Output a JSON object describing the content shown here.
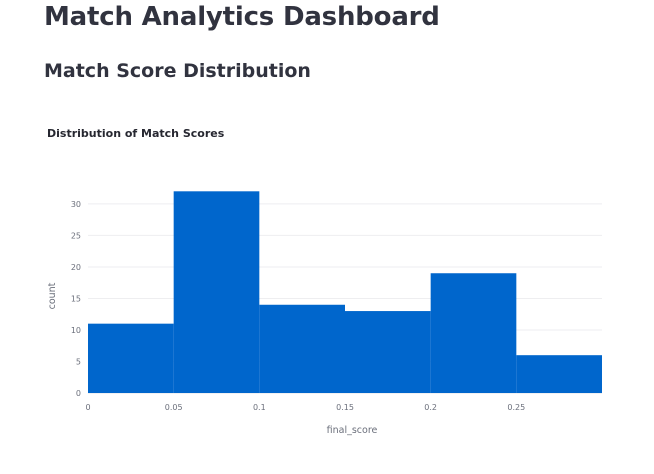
{
  "page": {
    "title": "Match Analytics Dashboard",
    "section_title": "Match Score Distribution"
  },
  "chart_data": {
    "type": "bar",
    "title": "Distribution of Match Scores",
    "xlabel": "final_score",
    "ylabel": "count",
    "bins": [
      {
        "x0": 0.0,
        "x1": 0.05,
        "count": 11
      },
      {
        "x0": 0.05,
        "x1": 0.1,
        "count": 32
      },
      {
        "x0": 0.1,
        "x1": 0.15,
        "count": 14
      },
      {
        "x0": 0.15,
        "x1": 0.2,
        "count": 13
      },
      {
        "x0": 0.2,
        "x1": 0.25,
        "count": 19
      },
      {
        "x0": 0.25,
        "x1": 0.3,
        "count": 6
      }
    ],
    "xlim": [
      0,
      0.3
    ],
    "ylim": [
      0,
      33
    ],
    "x_ticks": [
      0,
      0.05,
      0.1,
      0.15,
      0.2,
      0.25
    ],
    "x_tick_labels": [
      "0",
      "0.05",
      "0.1",
      "0.15",
      "0.2",
      "0.25"
    ],
    "y_ticks": [
      0,
      5,
      10,
      15,
      20,
      25,
      30
    ],
    "y_tick_labels": [
      "0",
      "5",
      "10",
      "15",
      "20",
      "25",
      "30"
    ],
    "bar_color": "#0066cc",
    "grid": true,
    "legend": false
  }
}
